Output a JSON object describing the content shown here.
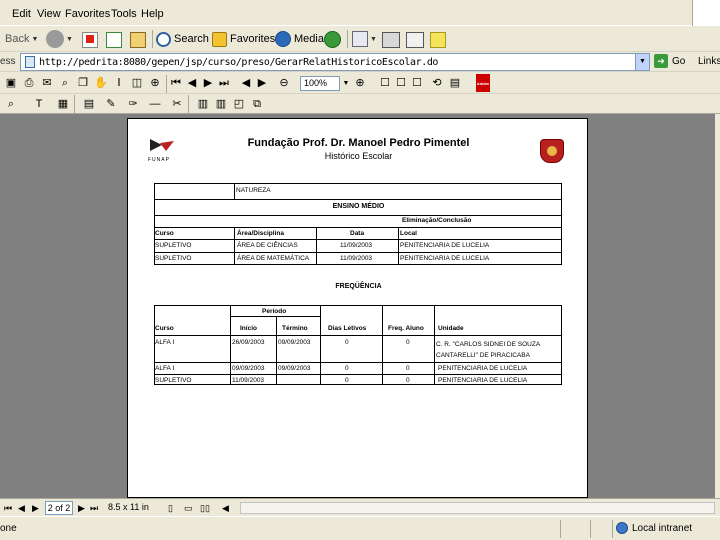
{
  "menu": [
    "Edit",
    "View",
    "Favorites",
    "Tools",
    "Help"
  ],
  "toolbar": {
    "back_label": "Back",
    "search_label": "Search",
    "favorites_label": "Favorites",
    "media_label": "Media"
  },
  "address": {
    "label": "ess",
    "url": "http://pedrita:8080/gepen/jsp/curso/preso/GerarRelatHistoricoEscolar.do",
    "go_label": "Go",
    "links_label": "Links"
  },
  "viewer": {
    "zoom": "100%",
    "adobe_label": "Adobe"
  },
  "document": {
    "title": "Fundação Prof. Dr. Manoel Pedro Pimentel",
    "subtitle": "Histórico Escolar",
    "logo_text": "FUNAP",
    "natureza_label": "NATUREZA",
    "section_ensino": "ENSINO MÉDIO",
    "eliminacao_header": "Eliminação/Conclusão",
    "table1": {
      "headers": [
        "Curso",
        "Área/Disciplina",
        "Data",
        "Local"
      ],
      "rows": [
        [
          "SUPLETIVO",
          "ÁREA DE CIÊNCIAS",
          "11/09/2003",
          "PENITENCIARIA DE LUCELIA"
        ],
        [
          "SUPLETIVO",
          "ÁREA DE MATEMÁTICA",
          "11/09/2003",
          "PENITENCIARIA DE LUCELIA"
        ]
      ]
    },
    "section_frequencia": "FREQÜÊNCIA",
    "periodo_header": "Período",
    "table2": {
      "headers": [
        "Curso",
        "Início",
        "Término",
        "Dias Letivos",
        "Freq. Aluno",
        "Unidade"
      ],
      "rows": [
        [
          "ALFA I",
          "26/09/2003",
          "09/09/2003",
          "0",
          "0",
          "C. R. \"CARLOS SIDNEI DE SOUZA CANTARELLI\" DE PIRACICABA"
        ],
        [
          "ALFA I",
          "09/09/2003",
          "09/09/2003",
          "0",
          "0",
          "PENITENCIARIA DE LUCELIA"
        ],
        [
          "SUPLETIVO",
          "11/09/2003",
          "",
          "0",
          "0",
          "PENITENCIARIA DE LUCELIA"
        ]
      ]
    }
  },
  "navbar": {
    "page_indicator": "2 of 2",
    "page_size": "8.5 x 11 in"
  },
  "status": {
    "left_text": "one",
    "zone": "Local intranet"
  }
}
